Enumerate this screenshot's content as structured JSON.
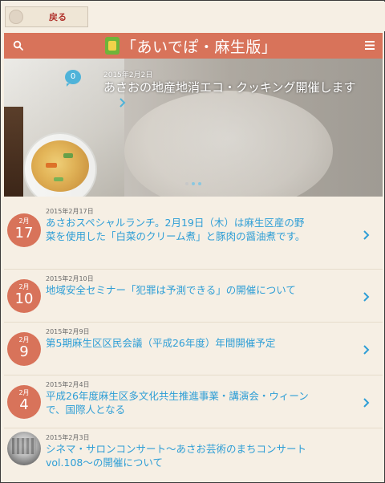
{
  "back": {
    "label": "戻る"
  },
  "header": {
    "title": "「あいでぽ・麻生版」",
    "search_icon": "search-icon",
    "menu_icon": "hamburger-menu-icon"
  },
  "hero": {
    "comment_count": "0",
    "date": "2015年2月2日",
    "title": "あさおの地産地消エコ・クッキング開催します"
  },
  "articles": [
    {
      "month": "2月",
      "day": "17",
      "date": "2015年2月17日",
      "title": "あさおスペシャルランチ。2月19日（木）は麻生区産の野菜を使用した「白菜のクリーム煮」と豚肉の醤油煮です。"
    },
    {
      "month": "2月",
      "day": "10",
      "date": "2015年2月10日",
      "title": "地域安全セミナー「犯罪は予測できる」の開催について"
    },
    {
      "month": "2月",
      "day": "9",
      "date": "2015年2月9日",
      "title": "第5期麻生区区民会議（平成26年度）年間開催予定"
    },
    {
      "month": "2月",
      "day": "4",
      "date": "2015年2月4日",
      "title": "平成26年度麻生区多文化共生推進事業・講演会・ウィーンで、国際人となる"
    },
    {
      "month": "",
      "day": "",
      "date": "2015年2月3日",
      "title": "シネマ・サロンコンサート～あさお芸術のまちコンサートvol.108～の開催について"
    }
  ],
  "colors": {
    "accent": "#d8735a",
    "link": "#2e9ed6",
    "background": "#f6efe4"
  }
}
